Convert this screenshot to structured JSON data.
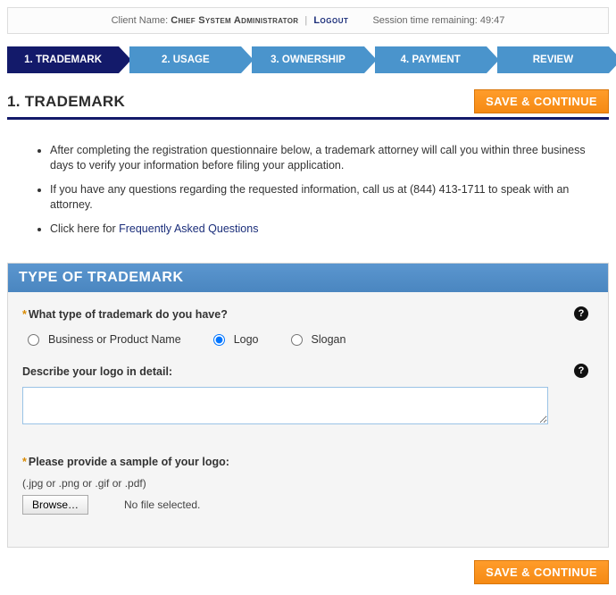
{
  "header": {
    "client_label": "Client Name: ",
    "client_name": "Chief System Administrator",
    "separator": " | ",
    "logout": "Logout",
    "session_label": "Session time remaining:  ",
    "session_time": "49:47"
  },
  "steps": [
    {
      "label": "1. TRADEMARK",
      "active": true
    },
    {
      "label": "2. USAGE",
      "active": false
    },
    {
      "label": "3. OWNERSHIP",
      "active": false
    },
    {
      "label": "4. PAYMENT",
      "active": false
    },
    {
      "label": "REVIEW",
      "active": false
    }
  ],
  "page_title": "1. TRADEMARK",
  "save_continue_label": "SAVE & CONTINUE",
  "intro": {
    "items": [
      "After completing the registration questionnaire below, a trademark attorney will call you within three business days to verify your information before filing your application.",
      "If you have any questions regarding the requested information, call us at (844) 413-1711 to speak with an attorney."
    ],
    "faq_prefix": "Click here for ",
    "faq_link_text": "Frequently Asked Questions"
  },
  "card": {
    "title": "TYPE OF TRADEMARK",
    "q_type": {
      "label": "What type of trademark do you have?",
      "options": [
        "Business or Product Name",
        "Logo",
        "Slogan"
      ],
      "selected_index": 1
    },
    "q_describe": {
      "label": "Describe your logo in detail:",
      "value": ""
    },
    "q_sample": {
      "label": "Please provide a sample of your logo:",
      "hint": "(.jpg or .png or .gif or .pdf)",
      "browse_label": "Browse…",
      "no_file_text": "No file selected."
    },
    "required_marker": "*",
    "help_glyph": "?"
  }
}
